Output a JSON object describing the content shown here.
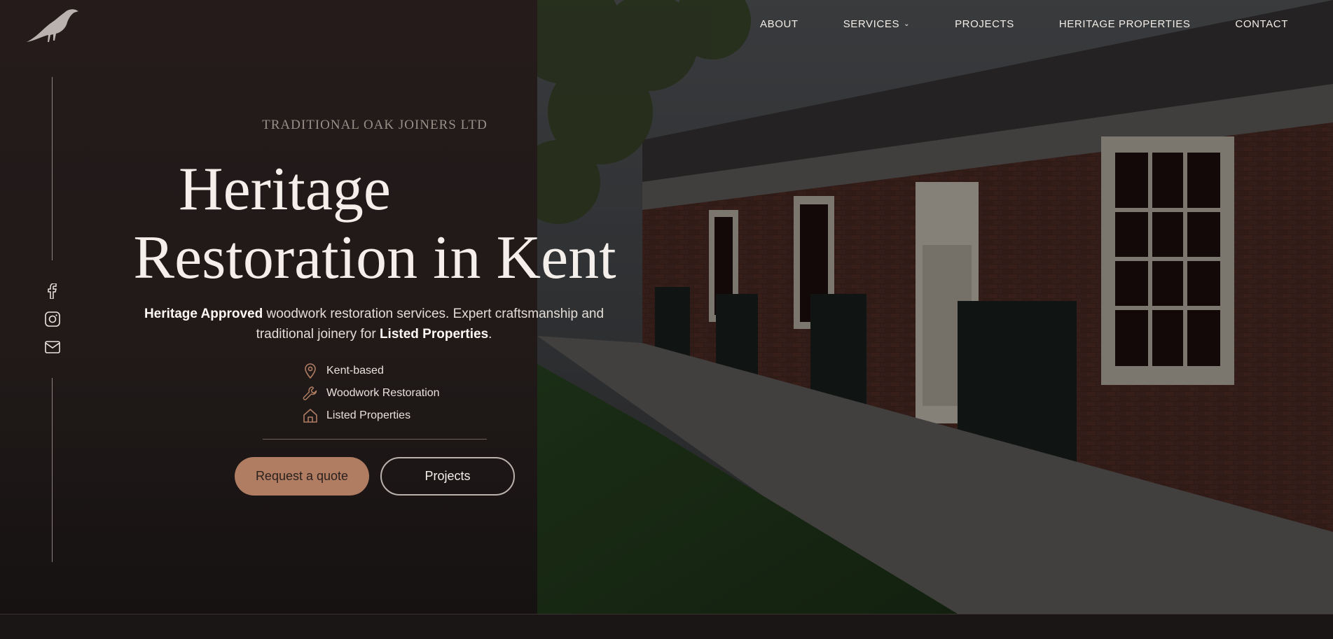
{
  "brand": {
    "logo_icon": "crow-icon"
  },
  "nav": {
    "items": [
      {
        "label": "ABOUT"
      },
      {
        "label": "SERVICES",
        "has_dropdown": true
      },
      {
        "label": "PROJECTS"
      },
      {
        "label": "HERITAGE PROPERTIES"
      },
      {
        "label": "CONTACT"
      }
    ]
  },
  "social": [
    {
      "icon": "facebook-icon"
    },
    {
      "icon": "instagram-icon"
    },
    {
      "icon": "mail-icon"
    }
  ],
  "hero": {
    "eyebrow": "TRADITIONAL OAK JOINERS LTD",
    "title_line1": "Heritage",
    "title_line2": "Restoration in Kent",
    "desc_bold1": "Heritage Approved",
    "desc_text1": " woodwork restoration services. Expert craftsmanship and traditional joinery for ",
    "desc_bold2": "Listed Properties",
    "desc_end": "."
  },
  "features": [
    {
      "icon": "map-pin-icon",
      "label": "Kent-based"
    },
    {
      "icon": "wrench-icon",
      "label": "Woodwork Restoration"
    },
    {
      "icon": "home-icon",
      "label": "Listed Properties"
    }
  ],
  "buttons": {
    "primary": "Request a quote",
    "secondary": "Projects"
  },
  "colors": {
    "accent": "#b07d63",
    "panel_bg": "#211a19",
    "text": "#f4efea"
  }
}
